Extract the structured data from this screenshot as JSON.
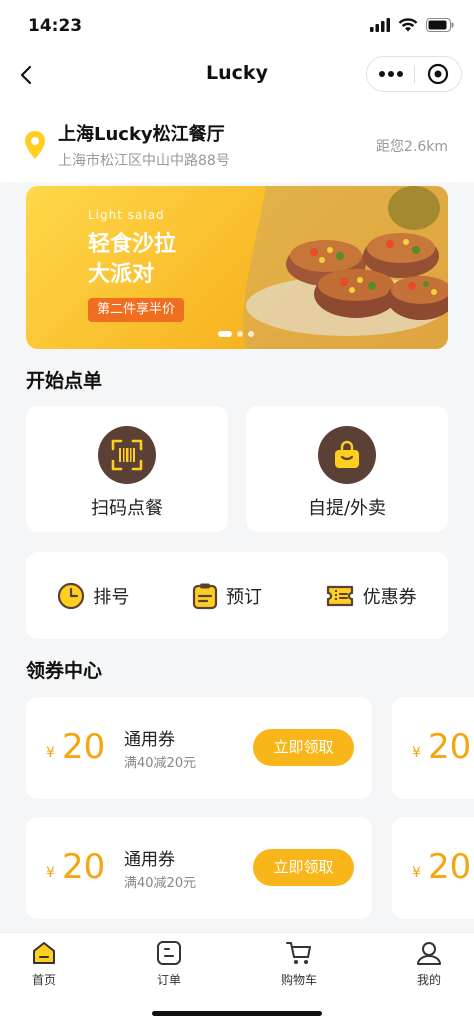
{
  "status_bar": {
    "time": "14:23"
  },
  "nav": {
    "title": "Lucky"
  },
  "store": {
    "name": "上海Lucky松江餐厅",
    "address": "上海市松江区中山中路88号",
    "distance": "距您2.6km"
  },
  "banner": {
    "subtitle_en": "Light salad",
    "line1": "轻食沙拉",
    "line2": "大派对",
    "tag": "第二件享半价"
  },
  "order_section": {
    "title": "开始点单",
    "big_options": [
      {
        "label": "扫码点餐",
        "icon": "scan-icon"
      },
      {
        "label": "自提/外卖",
        "icon": "bag-icon"
      }
    ],
    "quick_options": [
      {
        "label": "排号",
        "icon": "clock-icon"
      },
      {
        "label": "预订",
        "icon": "clipboard-icon"
      },
      {
        "label": "优惠券",
        "icon": "ticket-icon"
      }
    ]
  },
  "coupon_section": {
    "title": "领券中心",
    "coupons": [
      {
        "currency": "¥",
        "amount": "20",
        "title": "通用券",
        "desc": "满40减20元",
        "button": "立即领取"
      },
      {
        "currency": "¥",
        "amount": "20",
        "title": "通用券",
        "desc": "满40减20元",
        "button": "立即领取"
      }
    ],
    "peek": [
      {
        "currency": "¥",
        "amount": "20"
      },
      {
        "currency": "¥",
        "amount": "20"
      }
    ]
  },
  "tabbar": {
    "items": [
      {
        "label": "首页",
        "icon": "home-icon",
        "active": true
      },
      {
        "label": "订单",
        "icon": "order-icon",
        "active": false
      },
      {
        "label": "购物车",
        "icon": "cart-icon",
        "active": false
      },
      {
        "label": "我的",
        "icon": "profile-icon",
        "active": false
      }
    ]
  },
  "colors": {
    "accent": "#f9b61a",
    "brand_brown": "#5b4036",
    "price": "#f5a50f",
    "tag_orange": "#f06e1f"
  }
}
